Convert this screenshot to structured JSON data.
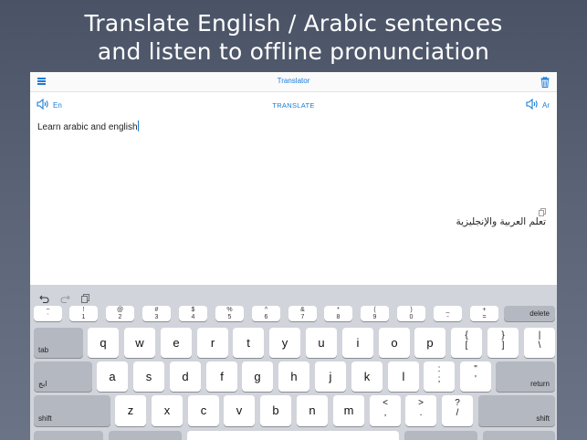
{
  "headline": {
    "line1": "Translate English / Arabic sentences",
    "line2": "and listen to offline pronunciation"
  },
  "navbar": {
    "title": "Translator",
    "menu_icon": "hamburger-menu-icon",
    "trash_icon": "trash-icon"
  },
  "langbar": {
    "source_lang": "En",
    "target_lang": "Ar",
    "translate_label": "TRANSLATE",
    "speaker_icon": "speaker-icon"
  },
  "input": {
    "value": "Learn arabic and english"
  },
  "output": {
    "value": "تعلم العربية والإنجليزية",
    "copy_icon": "copy-icon"
  },
  "keyboard": {
    "tools": [
      "undo-icon",
      "redo-icon",
      "paste-icon"
    ],
    "number_row": [
      {
        "top": "~",
        "bot": "`"
      },
      {
        "top": "!",
        "bot": "1"
      },
      {
        "top": "@",
        "bot": "2"
      },
      {
        "top": "#",
        "bot": "3"
      },
      {
        "top": "$",
        "bot": "4"
      },
      {
        "top": "%",
        "bot": "5"
      },
      {
        "top": "^",
        "bot": "6"
      },
      {
        "top": "&",
        "bot": "7"
      },
      {
        "top": "*",
        "bot": "8"
      },
      {
        "top": "(",
        "bot": "9"
      },
      {
        "top": ")",
        "bot": "0"
      },
      {
        "top": "_",
        "bot": "-"
      },
      {
        "top": "+",
        "bot": "="
      }
    ],
    "delete_label": "delete",
    "tab_label": "tab",
    "row1": [
      "q",
      "w",
      "e",
      "r",
      "t",
      "y",
      "u",
      "i",
      "o",
      "p"
    ],
    "row1_extra": [
      {
        "top": "{",
        "bot": "["
      },
      {
        "top": "}",
        "bot": "]"
      },
      {
        "top": "|",
        "bot": "\\"
      }
    ],
    "lang_switch_label": "ابج",
    "row2": [
      "a",
      "s",
      "d",
      "f",
      "g",
      "h",
      "j",
      "k",
      "l"
    ],
    "row2_extra": [
      {
        "top": ":",
        "bot": ";"
      },
      {
        "top": "\"",
        "bot": "'"
      }
    ],
    "return_label": "return",
    "shift_label": "shift",
    "row3": [
      "z",
      "x",
      "c",
      "v",
      "b",
      "n",
      "m"
    ],
    "row3_extra": [
      {
        "top": "<",
        "bot": ","
      },
      {
        "top": ">",
        "bot": "."
      },
      {
        "top": "?",
        "bot": "/"
      }
    ]
  },
  "colors": {
    "accent": "#1a7bd6",
    "background": "#55607a",
    "keyboard_bg": "#d1d4da",
    "dark_key": "#b3b8c1"
  }
}
